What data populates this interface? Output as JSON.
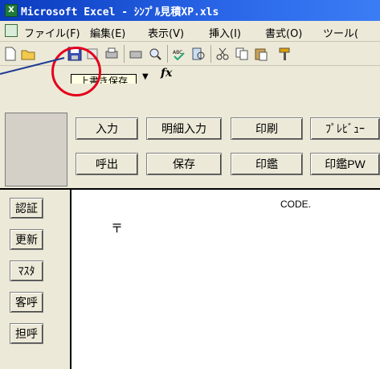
{
  "window": {
    "title": "Microsoft Excel - ｼﾝﾌﾟﾙ見積XP.xls"
  },
  "menu": [
    "ファイル(F)",
    "編集(E)",
    "表示(V)",
    "挿入(I)",
    "書式(O)",
    "ツール("
  ],
  "formula_bar": {
    "fx": "fx",
    "tooltip": "上書き保存"
  },
  "top_buttons": {
    "row1": [
      "入力",
      "明細入力",
      "印刷",
      "ﾌﾟﾚﾋﾞｭｰ"
    ],
    "row2": [
      "呼出",
      "保存",
      "印鑑",
      "印鑑PW"
    ]
  },
  "side_buttons": [
    "認証",
    "更新",
    "ﾏｽﾀ",
    "客呼",
    "担呼"
  ],
  "sheet": {
    "code_label": "CODE.",
    "postal_mark": "〒"
  },
  "colors": {
    "title_bar": "#0a3bbf",
    "annotation": "#e3001b",
    "face": "#ece9d8"
  },
  "icons": [
    "new-icon",
    "open-icon",
    "save-icon",
    "permission-icon",
    "print-icon",
    "print-preview-icon",
    "spelling-icon",
    "research-icon",
    "cut-icon",
    "copy-icon",
    "paste-icon",
    "format-painter-icon"
  ]
}
